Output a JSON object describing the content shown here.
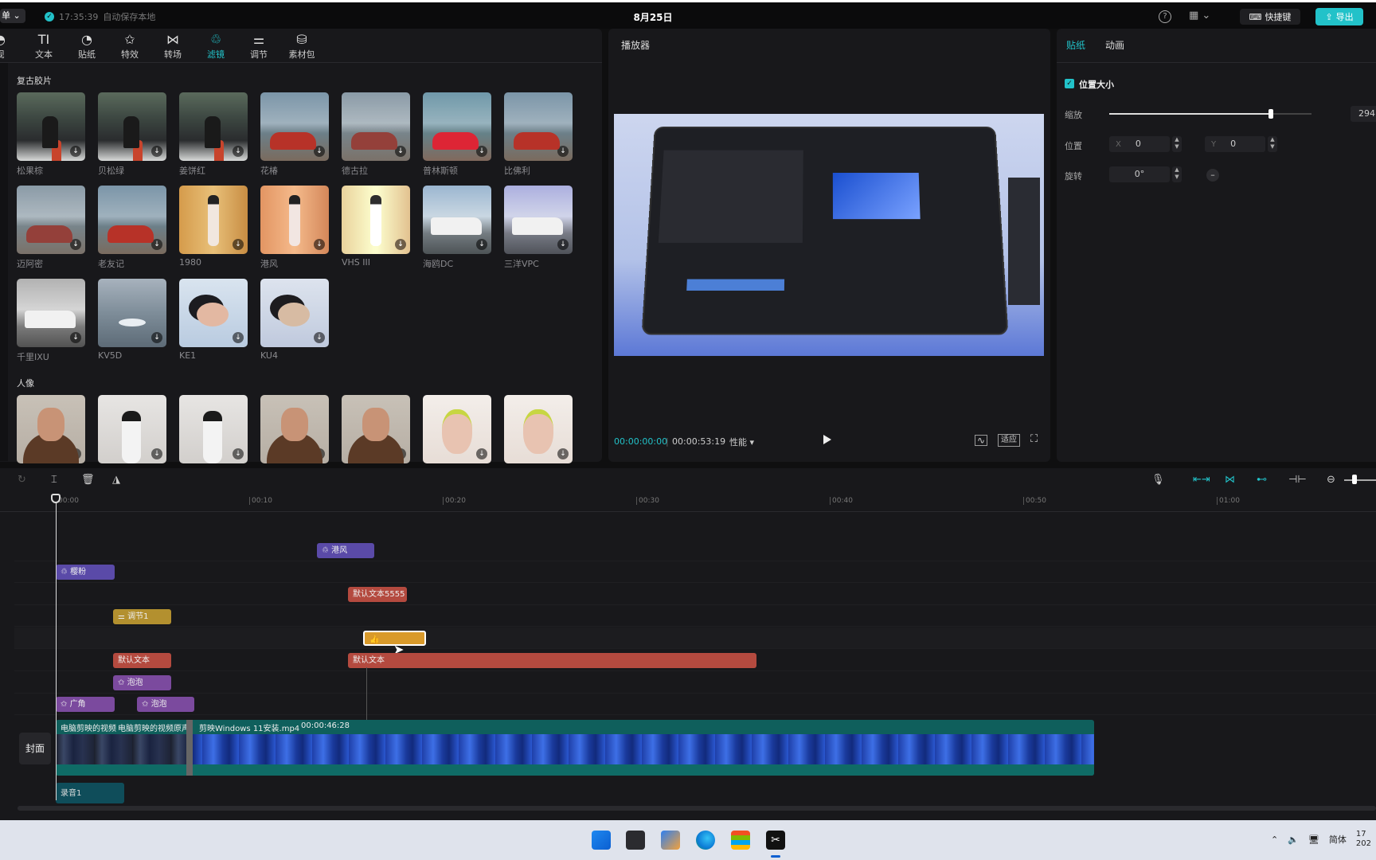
{
  "topbar": {
    "menu_label": "单",
    "autosave_time": "17:35:39",
    "autosave_text": "自动保存本地",
    "date": "8月25日",
    "shortcut_label": "快捷键",
    "export_label": "导出"
  },
  "tool_tabs": [
    {
      "label": "视频",
      "icon": "audio-icon"
    },
    {
      "label": "文本",
      "icon": "text-icon"
    },
    {
      "label": "贴纸",
      "icon": "sticker-icon"
    },
    {
      "label": "特效",
      "icon": "effects-icon"
    },
    {
      "label": "转场",
      "icon": "transition-icon"
    },
    {
      "label": "滤镜",
      "icon": "filter-icon"
    },
    {
      "label": "调节",
      "icon": "adjust-icon"
    },
    {
      "label": "素材包",
      "icon": "package-icon"
    }
  ],
  "active_tab": "滤镜",
  "filters": {
    "section1_title": "复古胶片",
    "section1": [
      {
        "label": "松果棕",
        "img": "forest"
      },
      {
        "label": "贝松绿",
        "img": "forest"
      },
      {
        "label": "姜饼红",
        "img": "forest"
      },
      {
        "label": "花椿",
        "img": "car"
      },
      {
        "label": "德古拉",
        "img": "car faded"
      },
      {
        "label": "普林斯顿",
        "img": "car warm"
      },
      {
        "label": "比佛利",
        "img": "car"
      },
      {
        "label": "迈阿密",
        "img": "car faded"
      },
      {
        "label": "老友记",
        "img": "car"
      },
      {
        "label": "1980",
        "img": "dancer"
      },
      {
        "label": "港风",
        "img": "dancer pink"
      },
      {
        "label": "VHS III",
        "img": "dancer pale"
      },
      {
        "label": "海鸥DC",
        "img": "truck"
      },
      {
        "label": "三洋VPC",
        "img": "truck purple"
      },
      {
        "label": "千里IXU",
        "img": "truck gray"
      },
      {
        "label": "KV5D",
        "img": "swan"
      },
      {
        "label": "KE1",
        "img": "pillow"
      },
      {
        "label": "KU4",
        "img": "pillow cool"
      }
    ],
    "section2_title": "人像",
    "section2": [
      {
        "img": "man"
      },
      {
        "img": "woman-white"
      },
      {
        "img": "woman-white"
      },
      {
        "img": "man"
      },
      {
        "img": "man"
      },
      {
        "img": "makeup"
      },
      {
        "img": "makeup"
      }
    ]
  },
  "player": {
    "title": "播放器",
    "time_current": "00:00:00:00",
    "time_total": "00:00:53:19",
    "perf_label": "性能",
    "fit_label": "适应"
  },
  "props": {
    "tab_sticker": "贴纸",
    "tab_animation": "动画",
    "pos_size_label": "位置大小",
    "scale_label": "缩放",
    "scale_value": "294",
    "scale_fraction": 0.8,
    "position_label": "位置",
    "x_axis": "X",
    "x_value": "0",
    "y_axis": "Y",
    "y_value": "0",
    "rotate_label": "旋转",
    "rotate_value": "0°"
  },
  "timeline": {
    "ruler": [
      "00:00",
      "00:10",
      "00:20",
      "00:30",
      "00:40",
      "00:50",
      "01:00"
    ],
    "clips": [
      {
        "label": "港风",
        "type": "purple",
        "icon": "filter-icon"
      },
      {
        "label": "樱粉",
        "type": "purple",
        "icon": "filter-icon"
      },
      {
        "label": "默认文本5555",
        "type": "red"
      },
      {
        "label": "调节1",
        "type": "gold",
        "icon": "adjust-icon"
      },
      {
        "label": "",
        "type": "sticker"
      },
      {
        "label": "默认文本",
        "type": "red"
      },
      {
        "label": "默认文本",
        "type": "red"
      },
      {
        "label": "泡泡",
        "type": "magenta",
        "icon": "effects-icon"
      },
      {
        "label": "广角",
        "type": "magenta",
        "icon": "effects-icon"
      },
      {
        "label": "泡泡",
        "type": "magenta",
        "icon": "effects-icon"
      }
    ],
    "cover_label": "封面",
    "main_track": {
      "clip1": "电脑剪映的视频",
      "clip2": "电脑剪映的视频原声",
      "clip3": "剪映Windows 11安装.mp4",
      "duration": "00:00:46:28"
    },
    "record_label": "录音1"
  },
  "taskbar": {
    "lang": "简体",
    "time": "17",
    "date": "202"
  }
}
